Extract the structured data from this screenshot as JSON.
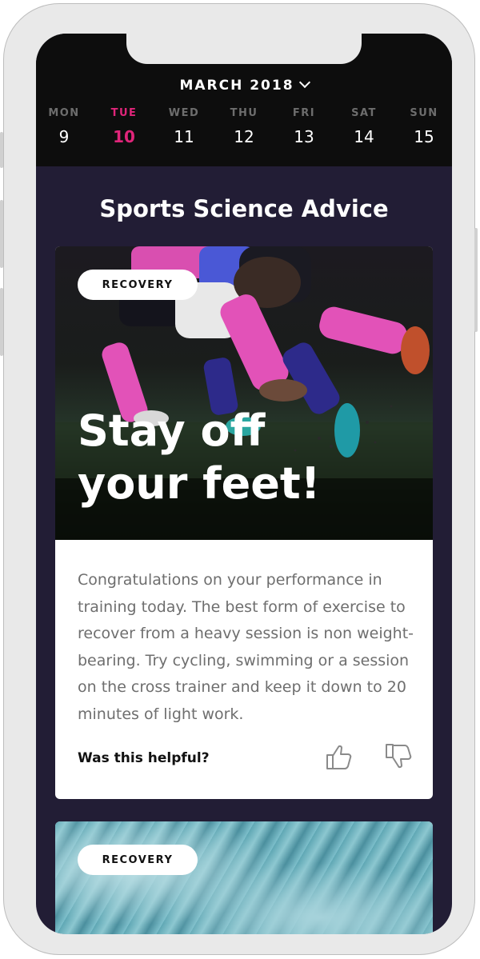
{
  "calendar": {
    "month_label": "MARCH 2018",
    "days": [
      {
        "name": "MON",
        "num": "9"
      },
      {
        "name": "TUE",
        "num": "10"
      },
      {
        "name": "WED",
        "num": "11"
      },
      {
        "name": "THU",
        "num": "12"
      },
      {
        "name": "FRI",
        "num": "13"
      },
      {
        "name": "SAT",
        "num": "14"
      },
      {
        "name": "SUN",
        "num": "15"
      }
    ],
    "active_day": "TUE",
    "accent_color": "#e0257a"
  },
  "section_title": "Sports Science Advice",
  "cards": [
    {
      "tag": "RECOVERY",
      "title_line1": "Stay off",
      "title_line2": "your feet!",
      "body": "Congratulations on your performance in training today. The best form of exercise to recover from a heavy session is non weight-bearing. Try cycling, swimming or a session on the cross trainer and keep it down to 20 minutes of light work.",
      "feedback_prompt": "Was this helpful?",
      "image": "football-players-icon"
    },
    {
      "tag": "RECOVERY",
      "image": "pool-water-icon"
    }
  ],
  "icons": {
    "chevron": "chevron-down-icon",
    "like": "thumbs-up-icon",
    "dislike": "thumbs-down-icon"
  }
}
